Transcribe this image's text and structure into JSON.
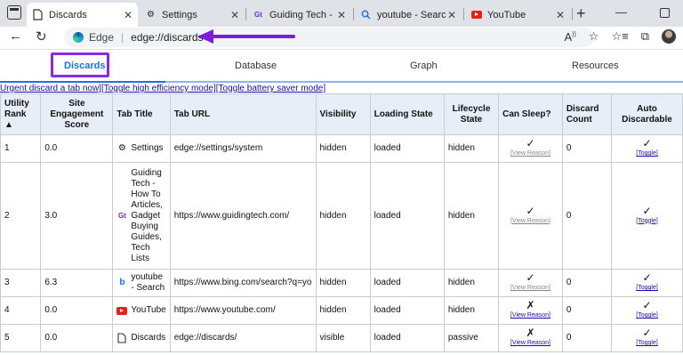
{
  "browser": {
    "tabs": [
      {
        "label": "Discards",
        "icon": "page-icon",
        "active": true
      },
      {
        "label": "Settings",
        "icon": "gear-icon",
        "active": false
      },
      {
        "label": "Guiding Tech - How",
        "icon": "guidingtech-icon",
        "active": false
      },
      {
        "label": "youtube - Search",
        "icon": "search-icon",
        "active": false
      },
      {
        "label": "YouTube",
        "icon": "youtube-icon",
        "active": false
      }
    ],
    "address": {
      "brand": "Edge",
      "url": "edge://discards"
    }
  },
  "page": {
    "subtabs": [
      "Discards",
      "Database",
      "Graph",
      "Resources"
    ],
    "actions_text": "Urgent discard a tab now][Toggle high efficiency mode][Toggle battery saver mode]",
    "columns": [
      "Utility Rank ▲",
      "Site Engagement Score",
      "Tab Title",
      "Tab URL",
      "Visibility",
      "Loading State",
      "Lifecycle State",
      "Can Sleep?",
      "Discard Count",
      "Auto Discardable"
    ],
    "rows": [
      {
        "rank": "1",
        "score": "0.0",
        "title": "Settings",
        "icon": "gear-icon",
        "url": "edge://settings/system",
        "visibility": "hidden",
        "loading": "loaded",
        "lifecycle": "hidden",
        "can_sleep": "✓",
        "reason": "[View Reason]",
        "discards": "0",
        "auto": "✓",
        "toggle": "[Toggle]"
      },
      {
        "rank": "2",
        "score": "3.0",
        "title": "Guiding Tech - How To Articles, Gadget Buying Guides, Tech Lists",
        "icon": "guidingtech-icon",
        "url": "https://www.guidingtech.com/",
        "visibility": "hidden",
        "loading": "loaded",
        "lifecycle": "hidden",
        "can_sleep": "✓",
        "reason": "[View Reason]",
        "discards": "0",
        "auto": "✓",
        "toggle": "[Toggle]"
      },
      {
        "rank": "3",
        "score": "6.3",
        "title": "youtube - Search",
        "icon": "bing-icon",
        "url": "https://www.bing.com/search?q=yo",
        "visibility": "hidden",
        "loading": "loaded",
        "lifecycle": "hidden",
        "can_sleep": "✓",
        "reason": "[View Reason]",
        "discards": "0",
        "auto": "✓",
        "toggle": "[Toggle]"
      },
      {
        "rank": "4",
        "score": "0.0",
        "title": "YouTube",
        "icon": "youtube-icon",
        "url": "https://www.youtube.com/",
        "visibility": "hidden",
        "loading": "loaded",
        "lifecycle": "hidden",
        "can_sleep": "✗",
        "reason": "[View Reason]",
        "discards": "0",
        "auto": "✓",
        "toggle": "[Toggle]"
      },
      {
        "rank": "5",
        "score": "0.0",
        "title": "Discards",
        "icon": "page-icon",
        "url": "edge://discards/",
        "visibility": "visible",
        "loading": "loaded",
        "lifecycle": "passive",
        "can_sleep": "✗",
        "reason": "[View Reason]",
        "discards": "0",
        "auto": "✓",
        "toggle": "[Toggle]"
      }
    ]
  }
}
